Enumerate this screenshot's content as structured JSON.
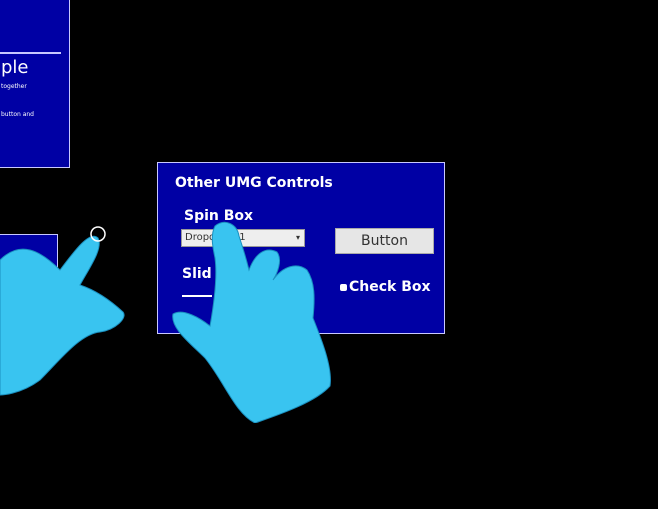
{
  "panel_top_left": {
    "title": "ple",
    "line1": "together",
    "line2": "button and"
  },
  "main_panel": {
    "heading": "Other UMG Controls",
    "spin_label": "Spin Box",
    "dropdown_value": "Dropdown 1",
    "button_label": "Button",
    "slider_label": "Slid",
    "checkbox_label": "Check Box"
  },
  "colors": {
    "panel_bg": "#0000a4",
    "hand": "#39c4f0",
    "background": "#000000"
  }
}
